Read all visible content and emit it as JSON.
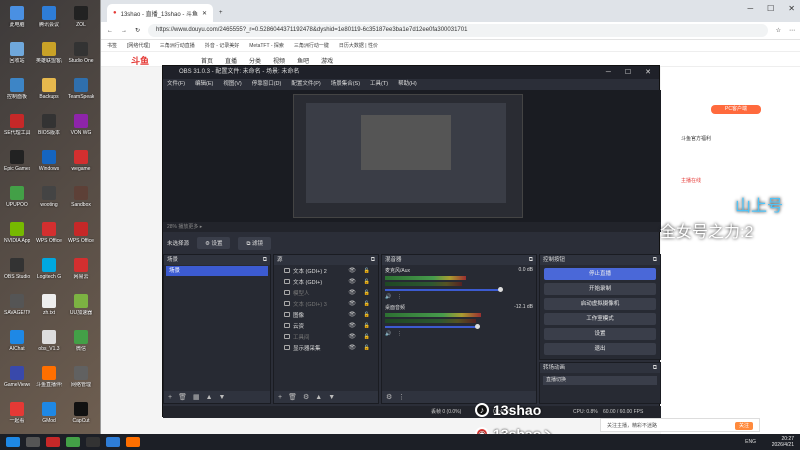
{
  "desktop": {
    "icons": [
      {
        "label": "此电脑",
        "color": "#4a90e2"
      },
      {
        "label": "腾讯会议",
        "color": "#2e7dd7"
      },
      {
        "label": "ZOL",
        "color": "#222"
      },
      {
        "label": "回收站",
        "color": "#6fa8dc"
      },
      {
        "label": "英雄联盟客户端",
        "color": "#c9a227"
      },
      {
        "label": "Studio One",
        "color": "#333"
      },
      {
        "label": "控制面板",
        "color": "#3d85c6"
      },
      {
        "label": "Backups",
        "color": "#e6b84d"
      },
      {
        "label": "TeamSpeak",
        "color": "#2f6fad"
      },
      {
        "label": "SE代理工具",
        "color": "#c62828"
      },
      {
        "label": "BIOS版本",
        "color": "#333"
      },
      {
        "label": "VON WG",
        "color": "#8e24aa"
      },
      {
        "label": "Epic Games",
        "color": "#222"
      },
      {
        "label": "Windows",
        "color": "#1565c0"
      },
      {
        "label": "wegame",
        "color": "#d32f2f"
      },
      {
        "label": "UPUPOO",
        "color": "#43a047"
      },
      {
        "label": "wooting",
        "color": "#444"
      },
      {
        "label": "Sandbox",
        "color": "#5d4037"
      },
      {
        "label": "NVIDIA App",
        "color": "#76b900"
      },
      {
        "label": "WPS Office",
        "color": "#d32f2f"
      },
      {
        "label": "WPS Office",
        "color": "#c62828"
      },
      {
        "label": "OBS Studio",
        "color": "#333"
      },
      {
        "label": "Logitech G",
        "color": "#00a8e0"
      },
      {
        "label": "网易云",
        "color": "#d32f2f"
      },
      {
        "label": "SAVAGE!TM",
        "color": "#555"
      },
      {
        "label": "zh.txt",
        "color": "#eee"
      },
      {
        "label": "UU加速器",
        "color": "#7cb342"
      },
      {
        "label": "AIChat",
        "color": "#1e88e5"
      },
      {
        "label": "obs_V1.3",
        "color": "#ddd"
      },
      {
        "label": "微信",
        "color": "#43a047"
      },
      {
        "label": "GameViewer",
        "color": "#3949ab"
      },
      {
        "label": "斗鱼直播伴侣",
        "color": "#ff6f00"
      },
      {
        "label": "网络管理",
        "color": "#616161"
      },
      {
        "label": "一起看",
        "color": "#e53935"
      },
      {
        "label": "GMod",
        "color": "#1e88e5"
      },
      {
        "label": "CapCut",
        "color": "#111"
      }
    ]
  },
  "browser": {
    "tabs": [
      {
        "label": "13shao - 直播_13shao - 斗鱼"
      },
      {
        "label": "+"
      }
    ],
    "url": "https://www.douyu.com/2465555?_r=0.5286044371192478&dyshid=1e80119-6c35187ee3ba1e7d12ee0fa300031701",
    "bookmarks": [
      "书签",
      "[网络代理]",
      "三角洲行动直播",
      "抖音 - 记录美好",
      "MetaTFT - 探索",
      "三角洲行动一键",
      "日历大数据 | 性价"
    ]
  },
  "site": {
    "logo": "斗鱼",
    "nav": [
      "首页",
      "直播",
      "分类",
      "视频",
      "鱼吧",
      "游戏"
    ],
    "pc": "PC客户端",
    "right": [
      "斗鱼官方福利",
      "主播在线"
    ]
  },
  "obs": {
    "title": "OBS 31.0.3 - 配置文件: 未命名 - 场景: 未命名",
    "menu": [
      "文件(F)",
      "编辑(E)",
      "视图(V)",
      "停靠窗口(D)",
      "配置文件(P)",
      "场景集合(S)",
      "工具(T)",
      "帮助(H)"
    ],
    "preview_bar": "28%  播放更多 ▸",
    "scene_bar": {
      "label": "未选择源",
      "props": "⚙ 设置",
      "filters": "⧉ 滤镜"
    },
    "docks": {
      "scenes": "场景",
      "sources": "源",
      "mixer": "混音器",
      "controls": "控制按钮",
      "transitions": "转场动画"
    },
    "scene_item": "场景",
    "sources": [
      {
        "name": "文本 (GDI+) 2",
        "dim": false
      },
      {
        "name": "文本 (GDI+)",
        "dim": false
      },
      {
        "name": "模型人",
        "dim": true
      },
      {
        "name": "文本 (GDI+) 3",
        "dim": true
      },
      {
        "name": "图像",
        "dim": false
      },
      {
        "name": "云资",
        "dim": false
      },
      {
        "name": "工具间",
        "dim": true
      },
      {
        "name": "显示器采集",
        "dim": false
      }
    ],
    "mixer": [
      {
        "name": "麦克风/Aux",
        "db": "0.0 dB",
        "level": 0.55,
        "vol": 0.78
      },
      {
        "name": "桌面音频",
        "db": "-12.1 dB",
        "level": 0.65,
        "vol": 0.62
      }
    ],
    "controls": [
      "停止直播",
      "开始录制",
      "启动虚拟摄像机",
      "工作室模式",
      "设置",
      "退出"
    ],
    "transition": "直播切换",
    "status": {
      "frames": "丢帧 0 (0.0%)",
      "time": "00:47:14",
      "cpu": "CPU: 0.8%",
      "fps": "60.00 / 60.00 FPS"
    }
  },
  "overlay": {
    "danmu": "全女号之力:2",
    "danmu2": "山上号",
    "wm1": "13shao",
    "wm2": "13shao丶",
    "notice": "关注主播，精彩不迷路",
    "close": "关注"
  },
  "taskbar": {
    "time": "20:27",
    "date": "2026/4/21",
    "lang": "ENG"
  }
}
